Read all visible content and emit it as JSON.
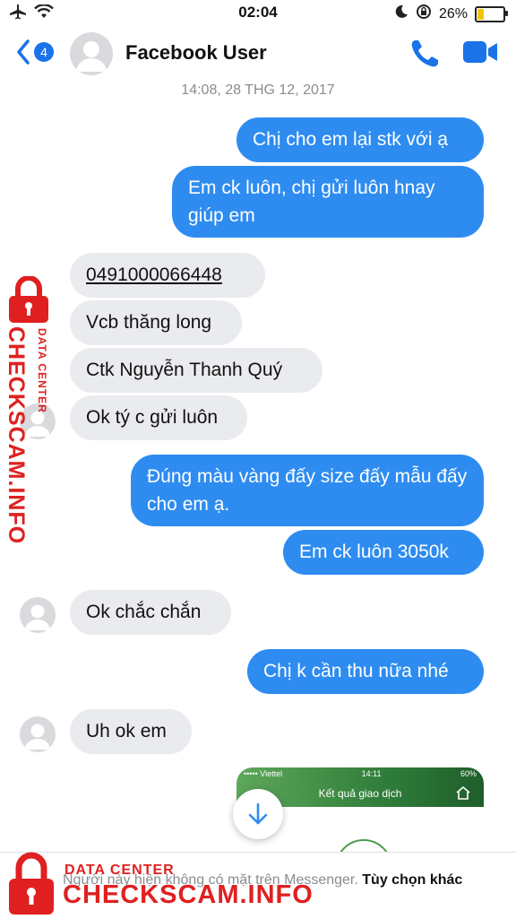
{
  "status_bar": {
    "time": "02:04",
    "battery_percent": "26%",
    "battery_level": 0.26,
    "icons": [
      "airplane-icon",
      "wifi-icon",
      "moon-icon",
      "rotation-lock-icon",
      "battery-icon"
    ]
  },
  "header": {
    "back_badge": "4",
    "contact_name": "Facebook User"
  },
  "conversation": {
    "timestamp": "14:08, 28 THG 12, 2017",
    "messages": [
      {
        "from": "me",
        "text": "Chị cho em lại stk với ạ"
      },
      {
        "from": "me",
        "text": "Em ck luôn, chị gửi luôn hnay giúp em"
      },
      {
        "from": "them",
        "text": "0491000066448"
      },
      {
        "from": "them",
        "text": "Vcb thăng long"
      },
      {
        "from": "them",
        "text": "Ctk Nguyễn Thanh Quý"
      },
      {
        "from": "them",
        "text": "Ok tý c gửi luôn"
      },
      {
        "from": "me",
        "text": "Đúng màu vàng đấy size đấy mẫu đấy cho em ạ."
      },
      {
        "from": "me",
        "text": "Em ck luôn 3050k"
      },
      {
        "from": "them",
        "text": "Ok chắc chắn"
      },
      {
        "from": "me",
        "text": "Chị k cần thu nữa nhé"
      },
      {
        "from": "them",
        "text": "Uh ok em"
      }
    ],
    "image_thumb": {
      "carrier": "••••• Viettel",
      "time": "14:11",
      "battery": "60%",
      "title": "Kết quả giao dịch"
    }
  },
  "footer": {
    "text": "Người này hiện không có mặt trên Messenger.",
    "action": "Tùy chọn khác"
  },
  "watermark": {
    "sub": "DATA CENTER",
    "main": "CHECKSCAM.INFO",
    "color": "#e02020"
  },
  "colors": {
    "outgoing_bubble": "#2e8cf0",
    "incoming_bubble": "#eaebee",
    "accent": "#1a73e8"
  }
}
